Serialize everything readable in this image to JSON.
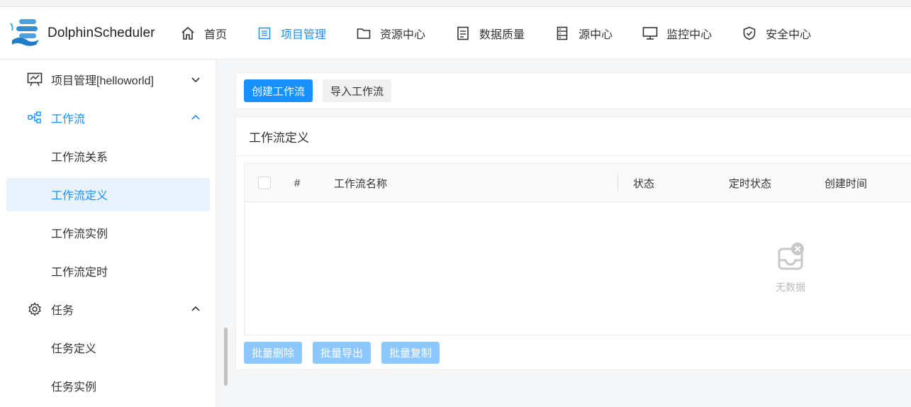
{
  "app": {
    "logo_text": "DolphinScheduler"
  },
  "nav": [
    {
      "label": "首页",
      "icon": "home-icon",
      "active": false
    },
    {
      "label": "项目管理",
      "icon": "project-icon",
      "active": true
    },
    {
      "label": "资源中心",
      "icon": "folder-icon",
      "active": false
    },
    {
      "label": "数据质量",
      "icon": "document-icon",
      "active": false
    },
    {
      "label": "源中心",
      "icon": "database-icon",
      "active": false
    },
    {
      "label": "监控中心",
      "icon": "monitor-icon",
      "active": false
    },
    {
      "label": "安全中心",
      "icon": "shield-icon",
      "active": false
    }
  ],
  "sidebar": {
    "project": {
      "label": "项目管理[helloworld]"
    },
    "workflow": {
      "label": "工作流",
      "items": [
        "工作流关系",
        "工作流定义",
        "工作流实例",
        "工作流定时"
      ],
      "active": "工作流定义"
    },
    "task": {
      "label": "任务",
      "items": [
        "任务定义",
        "任务实例"
      ]
    }
  },
  "toolbar": {
    "create_label": "创建工作流",
    "import_label": "导入工作流"
  },
  "card": {
    "title": "工作流定义"
  },
  "table": {
    "columns": {
      "index": "#",
      "name": "工作流名称",
      "status": "状态",
      "schedule_status": "定时状态",
      "create_time": "创建时间"
    },
    "empty_text": "无数据"
  },
  "batch": {
    "delete_label": "批量删除",
    "export_label": "批量导出",
    "copy_label": "批量复制"
  },
  "colors": {
    "primary": "#1890ff",
    "primary_disabled": "#8cc8ff",
    "active_bg": "#e8f3fd"
  }
}
